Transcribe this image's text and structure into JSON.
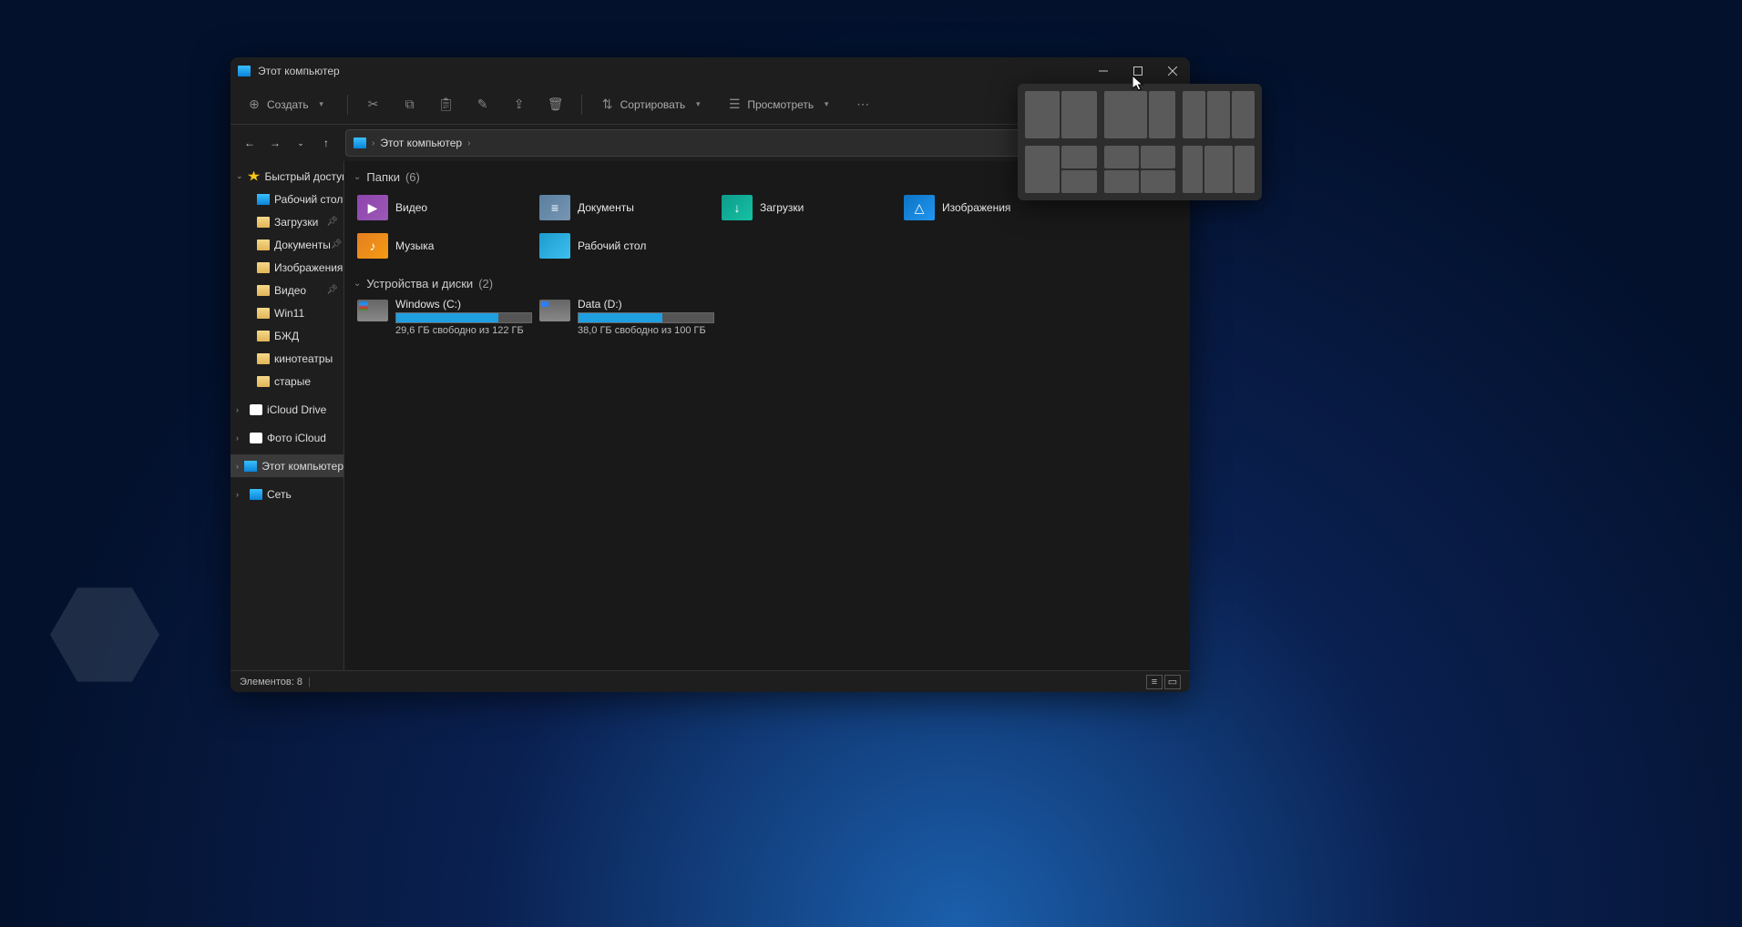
{
  "window": {
    "title": "Этот компьютер"
  },
  "toolbar": {
    "create": "Создать",
    "sort": "Сортировать",
    "view": "Просмотреть"
  },
  "breadcrumb": {
    "root": "Этот компьютер"
  },
  "sidebar": {
    "quick_access": "Быстрый доступ",
    "desktop": "Рабочий стол",
    "downloads": "Загрузки",
    "documents": "Документы",
    "pictures": "Изображения",
    "video": "Видео",
    "win11": "Win11",
    "bzhd": "БЖД",
    "kinoteatry": "кинотеатры",
    "starye": "старые",
    "icloud_drive": "iCloud Drive",
    "photo_icloud": "Фото iCloud",
    "this_pc": "Этот компьютер",
    "network": "Сеть"
  },
  "groups": {
    "folders": {
      "title": "Папки",
      "count": "(6)"
    },
    "devices": {
      "title": "Устройства и диски",
      "count": "(2)"
    }
  },
  "folders": {
    "video": "Видео",
    "documents": "Документы",
    "downloads": "Загрузки",
    "pictures": "Изображения",
    "music": "Музыка",
    "desktop": "Рабочий стол"
  },
  "drives": {
    "c": {
      "name": "Windows (C:)",
      "free": "29,6 ГБ свободно из 122 ГБ",
      "fill_pct": 76
    },
    "d": {
      "name": "Data (D:)",
      "free": "38,0 ГБ свободно из 100 ГБ",
      "fill_pct": 62
    }
  },
  "statusbar": {
    "items": "Элементов: 8"
  }
}
